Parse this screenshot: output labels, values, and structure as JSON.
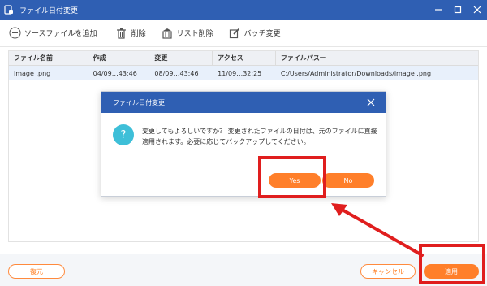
{
  "window": {
    "title": "ファイル日付変更"
  },
  "toolbar": {
    "add_source": "ソースファイルを追加",
    "delete": "削除",
    "list_delete": "リスト削除",
    "batch_change": "バッチ変更"
  },
  "table": {
    "headers": [
      "ファイル名前",
      "作成",
      "変更",
      "アクセス",
      "ファイルパス一"
    ],
    "rows": [
      [
        "image .png",
        "04/09…43:46",
        "08/09…43:46",
        "11/09…32:25",
        "C:/Users/Administrator/Downloads/image .png"
      ]
    ]
  },
  "footer": {
    "restore": "復元",
    "cancel": "キャンセル",
    "apply": "適用"
  },
  "dialog": {
    "title": "ファイル日付変更",
    "message": "変更してもよろしいですか？ 変更されたファイルの日付は、元のファイルに直接適用されます。必要に応じてバックアップしてください。",
    "yes": "Yes",
    "no": "No",
    "icon_glyph": "?"
  },
  "colors": {
    "titlebar": "#2f5fb3",
    "accent": "#ff7f2a",
    "highlight": "#e01e1e",
    "question_icon": "#3ebfd8"
  }
}
